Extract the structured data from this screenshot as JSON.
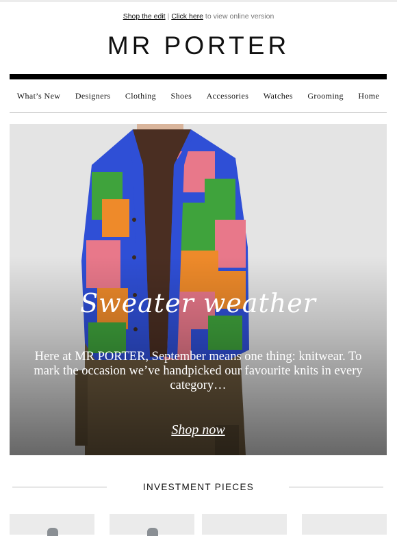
{
  "preheader": {
    "shop_link": "Shop the edit",
    "separator": "|",
    "click_link": "Click here",
    "trailing": " to view online version"
  },
  "brand": {
    "logo": "MR PORTER"
  },
  "nav": {
    "items": [
      "What’s New",
      "Designers",
      "Clothing",
      "Shoes",
      "Accessories",
      "Watches",
      "Grooming",
      "Home"
    ]
  },
  "hero": {
    "title": "Sweater weather",
    "body": "Here at MR PORTER, September means one thing: knitwear. To mark the occasion we’ve handpicked our favourite knits in every category…",
    "cta": "Shop now",
    "image_icon": "model-in-puzzle-cardigan-image"
  },
  "section": {
    "title": "INVESTMENT PIECES"
  },
  "colors": {
    "background": "#ffffff",
    "text": "#111111",
    "rule": "#000000",
    "cardigan_blue": "#2f4fd6",
    "cardigan_green": "#3fa33c",
    "cardigan_orange": "#ee8a2a",
    "cardigan_pink": "#e8788a"
  }
}
